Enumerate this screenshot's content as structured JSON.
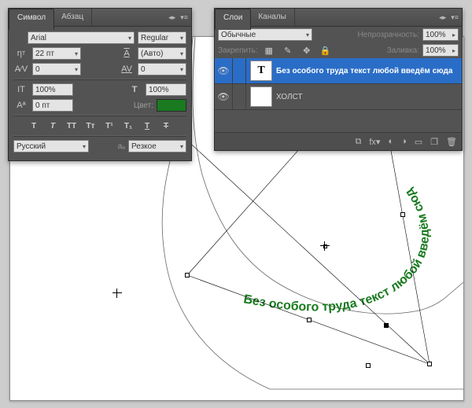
{
  "char_panel": {
    "tabs": {
      "symbol": "Символ",
      "paragraph": "Абзац"
    },
    "font_family": "Arial",
    "font_style": "Regular",
    "font_size": "22 пт",
    "leading": "(Авто)",
    "va_metrics": "0",
    "tracking": "0",
    "v_scale": "100%",
    "h_scale": "100%",
    "baseline": "0 пт",
    "color_label": "Цвет:",
    "color": "#197a1f",
    "language": "Русский",
    "aa_label": "aₐ",
    "antialias": "Резкое"
  },
  "layers_panel": {
    "tabs": {
      "layers": "Слои",
      "channels": "Каналы"
    },
    "blend_mode": "Обычные",
    "opacity_label": "Непрозрачность:",
    "opacity_value": "100%",
    "lock_label": "Закрепить:",
    "fill_label": "Заливка:",
    "fill_value": "100%",
    "layers": [
      {
        "name": "Без особого труда текст любой введём сюда",
        "thumb": "T",
        "selected": true
      },
      {
        "name": "ХОЛСТ",
        "thumb": "",
        "selected": false
      }
    ]
  },
  "canvas": {
    "text_on_path": "Без особого труда текст любой введём сюда",
    "text_color": "#197a1f"
  }
}
